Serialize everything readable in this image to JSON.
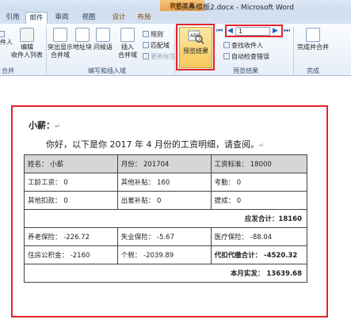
{
  "window": {
    "title": "工资条模板2.docx - Microsoft Word",
    "context_tab": "表格工具"
  },
  "tabs": [
    {
      "label": "引用"
    },
    {
      "label": "邮件"
    },
    {
      "label": "审阅"
    },
    {
      "label": "视图"
    },
    {
      "label": "设计"
    },
    {
      "label": "布局"
    }
  ],
  "ribbon": {
    "left_group": {
      "select_recipients_label": "选择\n收件人",
      "edit_list_label": "编辑\n收件人列表",
      "group_label": "合并"
    },
    "write_insert": {
      "highlight_fields": "突出显示\n合并域",
      "address_block": "地址块",
      "greeting_line": "问候语",
      "insert_field": "插入\n合并域",
      "rules": "规则",
      "match_fields": "匹配域",
      "update_labels": "更新标签",
      "group_label": "编写和插入域"
    },
    "preview": {
      "preview_button": "预览结果",
      "record_number": "1",
      "find_recipient": "查找收件人",
      "auto_check": "自动检查错误",
      "group_label": "预览结果"
    },
    "finish": {
      "finish_merge": "完成并合并",
      "group_label": "完成"
    }
  },
  "document": {
    "salutation": "小薪：",
    "intro": "你好，以下是你 2017 年 4 月份的工资明细，请查阅。",
    "rows": [
      [
        "姓名： 小薪",
        "月份： 201704",
        "工资标准： 18000"
      ],
      [
        "工龄工资： 0",
        "其他补贴： 160",
        "考勤： 0"
      ],
      [
        "其他扣款： 0",
        "出差补贴： 0",
        "提成： 0"
      ]
    ],
    "gross_total": "应发合计：18160",
    "deduction_rows": [
      [
        "养老保险： -226.72",
        "失业保险： -5.67",
        "医疗保险： -88.04"
      ],
      [
        "住房公积金： -2160",
        "个税： -2039.89",
        "代扣代缴合计： -4520.32"
      ]
    ],
    "net_pay": "本月实发： 13639.68"
  }
}
